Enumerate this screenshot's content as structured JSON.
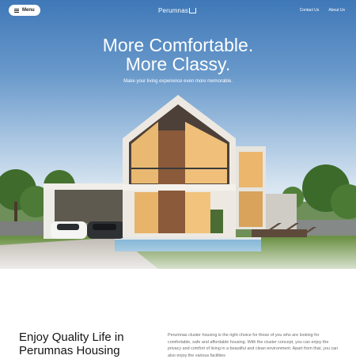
{
  "nav": {
    "menu_label": "Menu",
    "logo_text": "Perumnas",
    "links": [
      "Contact Us",
      "About Us"
    ]
  },
  "hero": {
    "title_line1": "More Comfortable.",
    "title_line2": "More Classy.",
    "subtitle": "Make your living experience even more memorable."
  },
  "section": {
    "title_line1": "Enjoy Quality Life in",
    "title_line2": "Perumnas Housing",
    "paragraph": "Perumnas cluster housing is the right choice for those of you who are looking for comfortable, safe and affordable housing. With the cluster concept, you can enjoy the privacy and comfort of living in a beautiful and clean environment. Apart from that, you can also enjoy the various facilities"
  }
}
